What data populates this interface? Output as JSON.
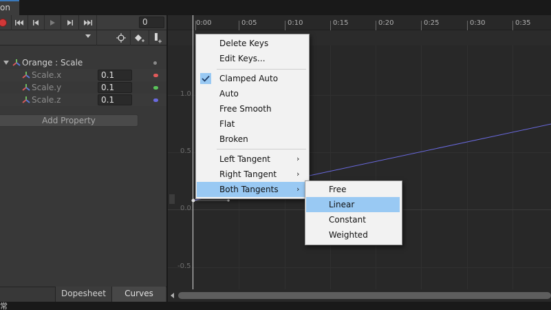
{
  "window": {
    "tab_label": "on"
  },
  "transport": {
    "frame_value": "0",
    "buttons": [
      "record",
      "first-key",
      "prev-key",
      "play",
      "next-key",
      "last-key"
    ]
  },
  "toolbar": {
    "icons": [
      "keyframe-snap-icon",
      "add-keyframe-icon",
      "add-event-icon"
    ]
  },
  "hierarchy": {
    "object": "Orange : Scale",
    "properties": [
      {
        "label": "Scale.x",
        "value": "0.1",
        "color": "#e05a5a"
      },
      {
        "label": "Scale.y",
        "value": "0.1",
        "color": "#5ac45a"
      },
      {
        "label": "Scale.z",
        "value": "0.1",
        "color": "#6a6ae0"
      }
    ],
    "add_property": "Add Property"
  },
  "view_tabs": {
    "dopesheet": "Dopesheet",
    "curves": "Curves"
  },
  "timeline": {
    "ticks": [
      "0:00",
      "0:05",
      "0:10",
      "0:15",
      "0:20",
      "0:25",
      "0:30",
      "0:35"
    ],
    "y_labels": [
      "1.0",
      "0.5",
      "0.0",
      "-0.5"
    ]
  },
  "context_menu": {
    "items": [
      "Delete Keys",
      "Edit Keys...",
      "Clamped Auto",
      "Auto",
      "Free Smooth",
      "Flat",
      "Broken",
      "Left Tangent",
      "Right Tangent",
      "Both Tangents"
    ],
    "checked": "Clamped Auto",
    "highlighted": "Both Tangents"
  },
  "submenu": {
    "items": [
      "Free",
      "Linear",
      "Constant",
      "Weighted"
    ],
    "highlighted": "Linear"
  },
  "status_bar": {
    "text": "常"
  },
  "colors": {
    "accent": "#3a79bb",
    "menu_highlight": "#99c9f3",
    "curve": "#6a6ae0"
  }
}
